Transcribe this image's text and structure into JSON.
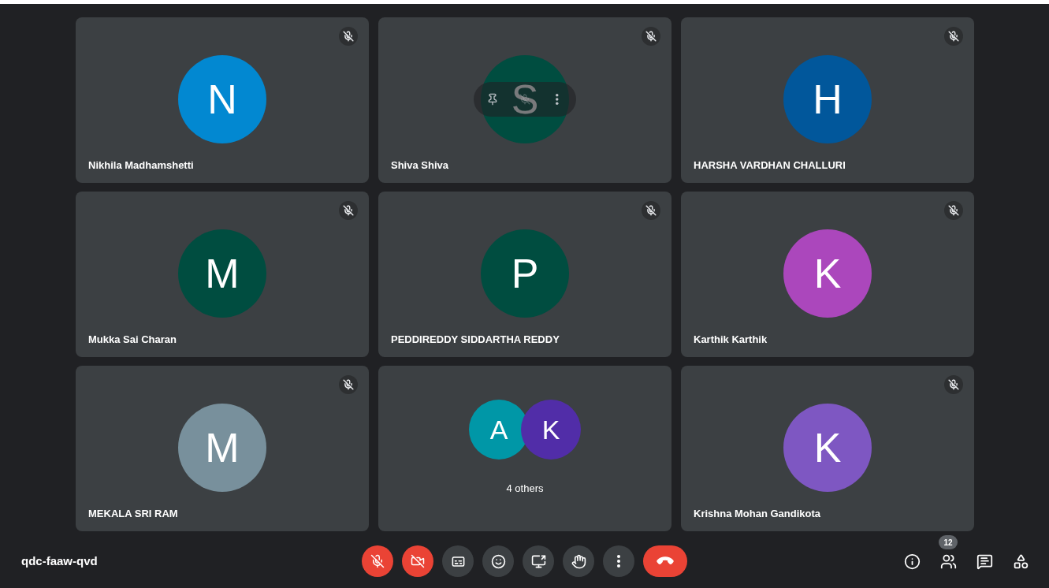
{
  "tiles": [
    {
      "kind": "person",
      "name": "Nikhila Madhamshetti",
      "initial": "N",
      "color": "#0288d1",
      "muted": true,
      "hovered": false
    },
    {
      "kind": "person",
      "name": "Shiva Shiva",
      "initial": "S",
      "color": "#004d40",
      "muted": true,
      "hovered": true
    },
    {
      "kind": "person",
      "name": "HARSHA VARDHAN CHALLURI",
      "initial": "H",
      "color": "#01579b",
      "muted": true,
      "hovered": false
    },
    {
      "kind": "person",
      "name": "Mukka Sai Charan",
      "initial": "M",
      "color": "#004d40",
      "muted": true,
      "hovered": false
    },
    {
      "kind": "person",
      "name": "PEDDIREDDY SIDDARTHA REDDY",
      "initial": "P",
      "color": "#004d40",
      "muted": true,
      "hovered": false
    },
    {
      "kind": "person",
      "name": "Karthik Karthik",
      "initial": "K",
      "color": "#ab47bc",
      "muted": true,
      "hovered": false
    },
    {
      "kind": "person",
      "name": "MEKALA SRI RAM",
      "initial": "M",
      "color": "#78909c",
      "muted": true,
      "hovered": false
    },
    {
      "kind": "group",
      "label": "4 others",
      "avatars": [
        {
          "initial": "A",
          "color": "#0097a7"
        },
        {
          "initial": "K",
          "color": "#512da8"
        }
      ]
    },
    {
      "kind": "person",
      "name": "Krishna Mohan Gandikota",
      "initial": "K",
      "color": "#7e57c2",
      "muted": true,
      "hovered": false
    }
  ],
  "meeting_code": "qdc-faaw-qvd",
  "controls": [
    {
      "kind": "mic",
      "off": true
    },
    {
      "kind": "camera",
      "off": true
    },
    {
      "kind": "captions"
    },
    {
      "kind": "emoji"
    },
    {
      "kind": "present"
    },
    {
      "kind": "hand"
    },
    {
      "kind": "more"
    },
    {
      "kind": "hangup"
    }
  ],
  "side_buttons": [
    {
      "kind": "info"
    },
    {
      "kind": "people",
      "badge": "12"
    },
    {
      "kind": "chat"
    },
    {
      "kind": "activities"
    }
  ]
}
